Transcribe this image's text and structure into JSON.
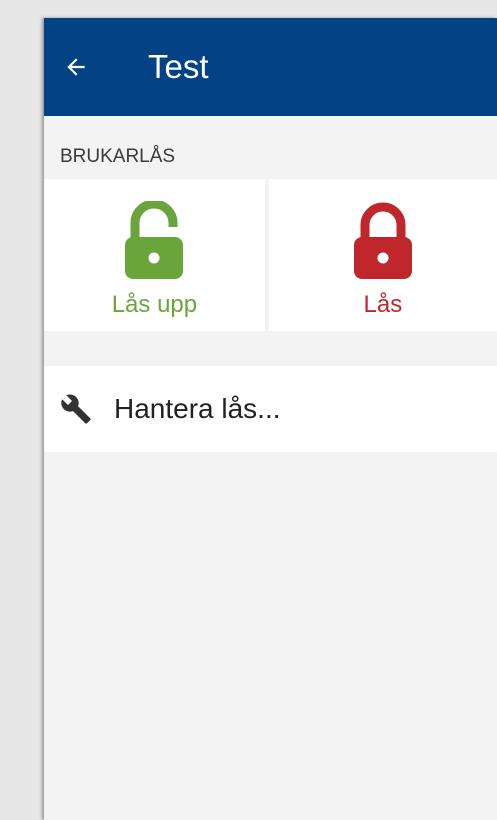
{
  "app_bar": {
    "title": "Test",
    "background_color": "#024285",
    "back_icon": "arrow-left-icon"
  },
  "section": {
    "header": "BRUKARLÅS"
  },
  "locks": [
    {
      "label": "Lås upp",
      "icon": "unlocked-padlock-icon",
      "color": "#6aa53b"
    },
    {
      "label": "Lås",
      "icon": "locked-padlock-icon",
      "color": "#c0272d"
    }
  ],
  "manage": {
    "label": "Hantera lås...",
    "icon": "wrench-icon"
  }
}
